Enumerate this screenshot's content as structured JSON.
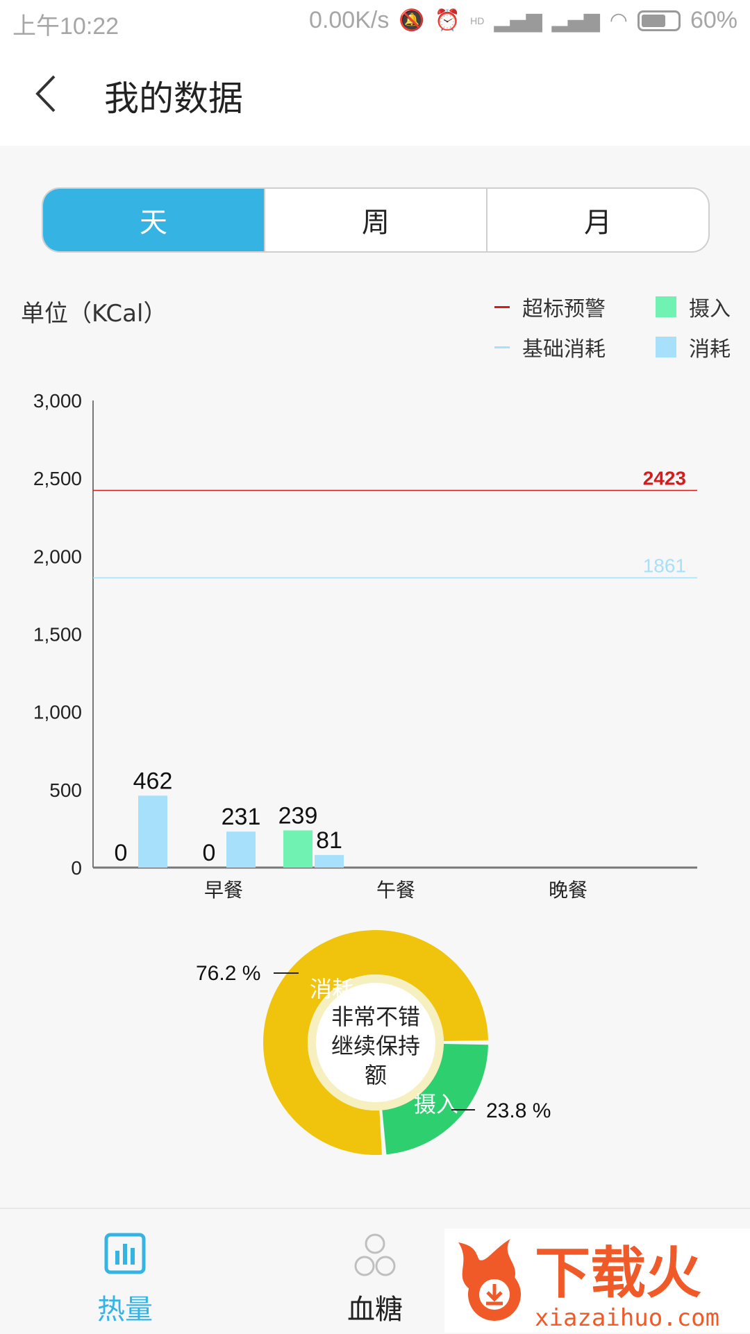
{
  "status_bar": {
    "time": "上午10:22",
    "network_speed": "0.00K/s",
    "network_type": "HD",
    "battery": "60%"
  },
  "app_bar": {
    "title": "我的数据"
  },
  "period_tabs": {
    "items": [
      "天",
      "周",
      "月"
    ],
    "selected": "天"
  },
  "chart_header": {
    "unit": "单位（KCal）",
    "legend": {
      "over_warning": "超标预警",
      "base_consumption": "基础消耗",
      "intake": "摄入",
      "consumption": "消耗"
    }
  },
  "colors": {
    "accent": "#35b4e4",
    "intake": "#6ff2b2",
    "consumption": "#a6e0fb",
    "warning_line": "#d61b1b",
    "base_line": "#a6e0fb",
    "donut_consumption": "#f0c40c",
    "donut_intake": "#2dcf6f",
    "nav_active": "#35b4e4"
  },
  "chart_data": {
    "type": "bar",
    "categories": [
      "",
      "早餐",
      "午餐",
      "晚餐"
    ],
    "ylim": [
      0,
      3000
    ],
    "yticks": [
      "0",
      "500",
      "1,000",
      "1,500",
      "2,000",
      "2,500",
      "3,000"
    ],
    "series": [
      {
        "name": "摄入",
        "values": [
          0,
          0,
          239,
          null
        ],
        "labels": [
          "0",
          "0",
          "239",
          ""
        ]
      },
      {
        "name": "消耗",
        "values": [
          462,
          231,
          81,
          null
        ],
        "labels": [
          "462",
          "231",
          "81",
          ""
        ]
      }
    ],
    "reference_lines": [
      {
        "name": "超标预警",
        "value": 2423,
        "label": "2423"
      },
      {
        "name": "基础消耗",
        "value": 1861,
        "label": "1861"
      }
    ]
  },
  "donut": {
    "center_text": [
      "非常不错",
      "继续保持",
      "额"
    ],
    "segments": [
      {
        "label": "消耗",
        "percent_label": "76.2 %",
        "value": 76.2
      },
      {
        "label": "摄入",
        "percent_label": "23.8 %",
        "value": 23.8
      }
    ]
  },
  "bottom_nav": {
    "items": [
      {
        "label": "热量",
        "icon": "chart-icon",
        "active": true
      },
      {
        "label": "血糖",
        "icon": "molecule-icon",
        "active": false
      }
    ]
  },
  "watermark": {
    "text": "下载火",
    "url": "xiazaihuo.com"
  }
}
